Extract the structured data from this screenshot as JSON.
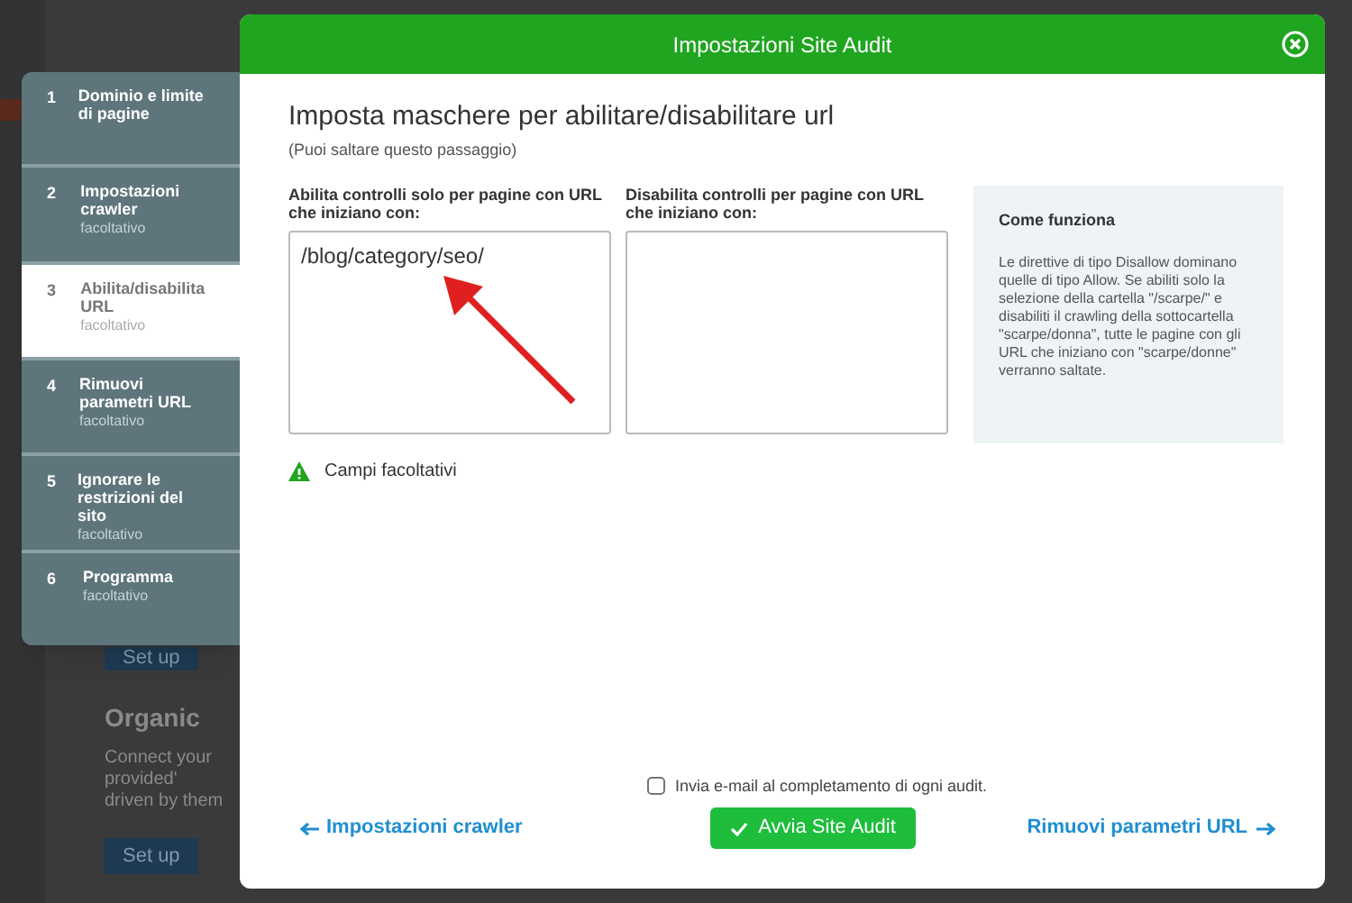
{
  "background_page": {
    "setup_buttons": [
      "Set up",
      "Set up"
    ],
    "card_title": "Organic",
    "card_text": [
      "Connect your",
      "provided'",
      "driven by them"
    ]
  },
  "steps": [
    {
      "number": "1",
      "title": "Dominio e limite di pagine",
      "selected": false
    },
    {
      "number": "2",
      "title": "Impostazioni crawler",
      "subtitle": "facoltativo",
      "selected": false
    },
    {
      "number": "3",
      "title": "Abilita/disabilita URL",
      "subtitle": "facoltativo",
      "selected": true
    },
    {
      "number": "4",
      "title": "Rimuovi parametri URL",
      "subtitle": "facoltativo",
      "selected": false
    },
    {
      "number": "5",
      "title": "Ignorare le restrizioni del sito",
      "subtitle": "facoltativo",
      "selected": false
    },
    {
      "number": "6",
      "title": "Programma",
      "subtitle": "facoltativo",
      "selected": false
    }
  ],
  "dialog": {
    "title": "Impostazioni Site Audit",
    "heading": "Imposta maschere per abilitare/disabilitare url",
    "subheading": "(Puoi saltare questo passaggio)",
    "fields": [
      {
        "label": "Abilita controlli solo per pagine con URL che iniziano con:",
        "value": "/blog/category/seo/"
      },
      {
        "label": "Disabilita controlli per pagine con URL che iniziano con:"
      }
    ],
    "info": {
      "title": "Come funziona",
      "text": "Le direttive di tipo Disallow dominano quelle di tipo Allow. Se abiliti solo la selezione della cartella \"/scarpe/\" e disabiliti il crawling della sottocartella \"scarpe/donna\", tutte le pagine con gli URL che iniziano con \"scarpe/donne\" verranno saltate."
    },
    "warning": "Campi facoltativi",
    "email_checkbox": {
      "label": "Invia e-mail al completamento di ogni audit.",
      "checked": false
    },
    "back_link": "Impostazioni crawler",
    "start_button": "Avvia Site Audit",
    "next_link": "Rimuovi parametri URL"
  }
}
